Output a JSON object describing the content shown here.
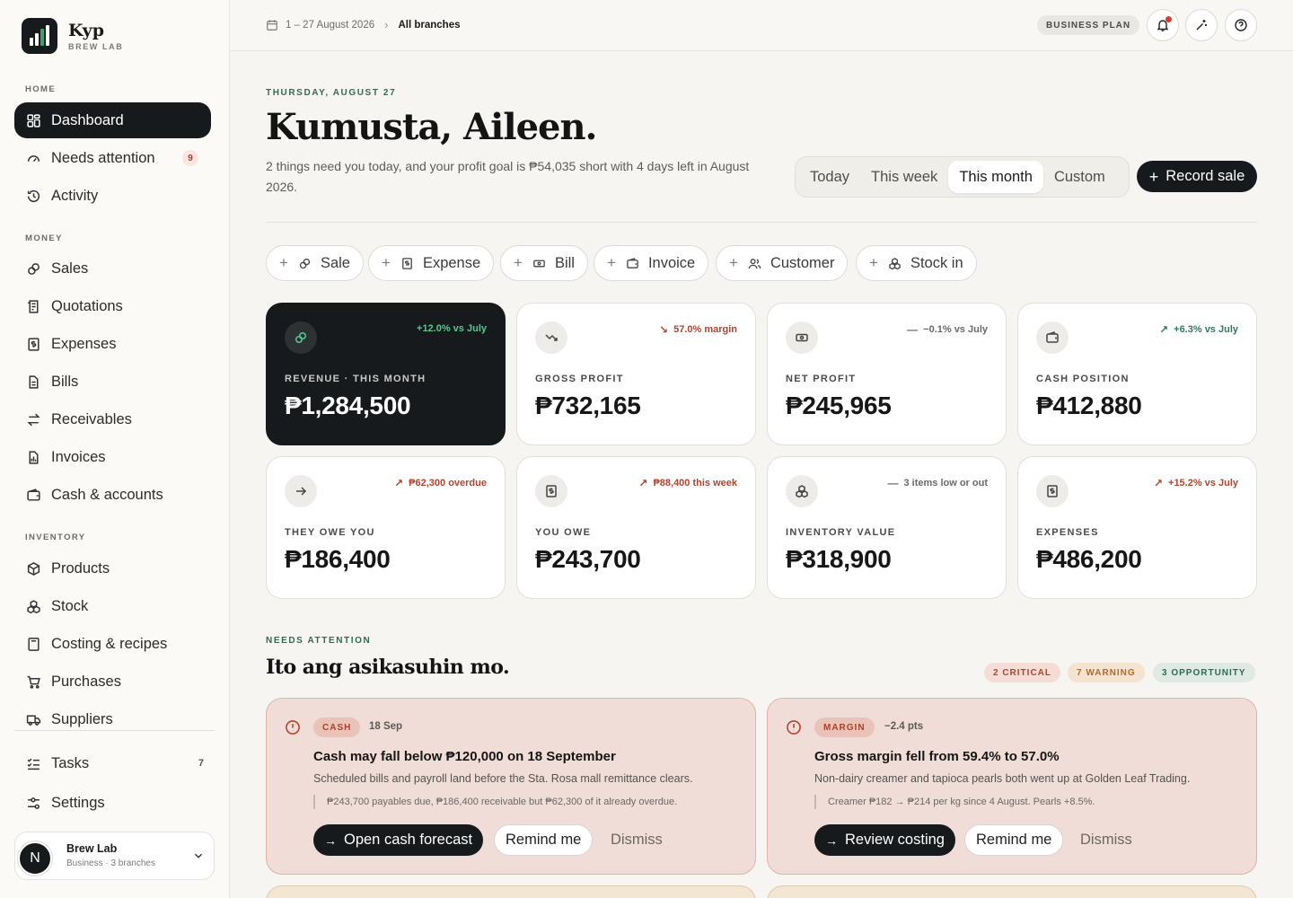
{
  "brand": {
    "name": "Kyp",
    "sub": "BREW LAB"
  },
  "sidebar": {
    "sections": {
      "home": "HOME",
      "money": "MONEY",
      "inventory": "INVENTORY"
    },
    "items": {
      "dashboard": "Dashboard",
      "needs_attention": "Needs attention",
      "needs_attention_badge": "9",
      "activity": "Activity",
      "sales": "Sales",
      "quotations": "Quotations",
      "expenses": "Expenses",
      "bills": "Bills",
      "receivables": "Receivables",
      "invoices": "Invoices",
      "cash_accounts": "Cash & accounts",
      "products": "Products",
      "stock": "Stock",
      "costing": "Costing & recipes",
      "purchases": "Purchases",
      "suppliers": "Suppliers",
      "tasks": "Tasks",
      "tasks_count": "7",
      "settings": "Settings"
    },
    "account": {
      "initial": "N",
      "name": "Brew Lab",
      "sub": "Business · 3 branches"
    }
  },
  "topbar": {
    "date_range": "1 – 27 August 2026",
    "branch": "All branches",
    "plan": "BUSINESS PLAN"
  },
  "header": {
    "date": "THURSDAY, AUGUST 27",
    "greeting": "Kumusta, Aileen.",
    "subtitle": "2 things need you today, and your profit goal is ₱54,035 short with 4 days left in August 2026.",
    "periods": [
      "Today",
      "This week",
      "This month",
      "Custom"
    ],
    "selected_period": "This month",
    "record_label": "Record sale"
  },
  "quick_add": [
    "Sale",
    "Expense",
    "Bill",
    "Invoice",
    "Customer",
    "Stock in"
  ],
  "kpis": [
    {
      "label": "REVENUE · THIS MONTH",
      "value": "₱1,284,500",
      "delta": "+12.0% vs July",
      "icon": "link-icon"
    },
    {
      "label": "GROSS PROFIT",
      "value": "₱732,165",
      "delta": "57.0% margin",
      "icon": "trend-down-icon"
    },
    {
      "label": "NET PROFIT",
      "value": "₱245,965",
      "delta": "−0.1% vs July",
      "icon": "money-icon"
    },
    {
      "label": "CASH POSITION",
      "value": "₱412,880",
      "delta": "+6.3% vs July",
      "icon": "wallet-icon"
    },
    {
      "label": "THEY OWE YOU",
      "value": "₱186,400",
      "delta": "₱62,300 overdue",
      "icon": "arrow-right-icon"
    },
    {
      "label": "YOU OWE",
      "value": "₱243,700",
      "delta": "₱88,400 this week",
      "icon": "receipt-icon"
    },
    {
      "label": "INVENTORY VALUE",
      "value": "₱318,900",
      "delta": "3 items low or out",
      "icon": "boxes-icon"
    },
    {
      "label": "EXPENSES",
      "value": "₱486,200",
      "delta": "+15.2% vs July",
      "icon": "receipt-icon"
    }
  ],
  "needs_attention": {
    "label": "NEEDS ATTENTION",
    "title": "Ito ang asikasuhin mo.",
    "pills": {
      "critical": "2 CRITICAL",
      "warning": "7 WARNING",
      "opportunity": "3 OPPORTUNITY"
    },
    "alerts": [
      {
        "tag": "CASH",
        "meta": "18 Sep",
        "title": "Cash may fall below ₱120,000 on 18 September",
        "desc": "Scheduled bills and payroll land before the Sta. Rosa mall remittance clears.",
        "note": "₱243,700 payables due, ₱186,400 receivable but ₱62,300 of it already overdue.",
        "primary": "Open cash forecast",
        "secondary": "Remind me",
        "dismiss": "Dismiss"
      },
      {
        "tag": "MARGIN",
        "meta": "−2.4 pts",
        "title": "Gross margin fell from 59.4% to 57.0%",
        "desc": "Non-dairy creamer and tapioca pearls both went up at Golden Leaf Trading.",
        "note": "Creamer ₱182 → ₱214 per kg since 4 August. Pearls +8.5%.",
        "primary": "Review costing",
        "secondary": "Remind me",
        "dismiss": "Dismiss"
      }
    ]
  },
  "colors": {
    "dark": "#171a1c",
    "accent_green": "#2f6b57",
    "critical": "#b0442c",
    "warning": "#b4692a"
  }
}
